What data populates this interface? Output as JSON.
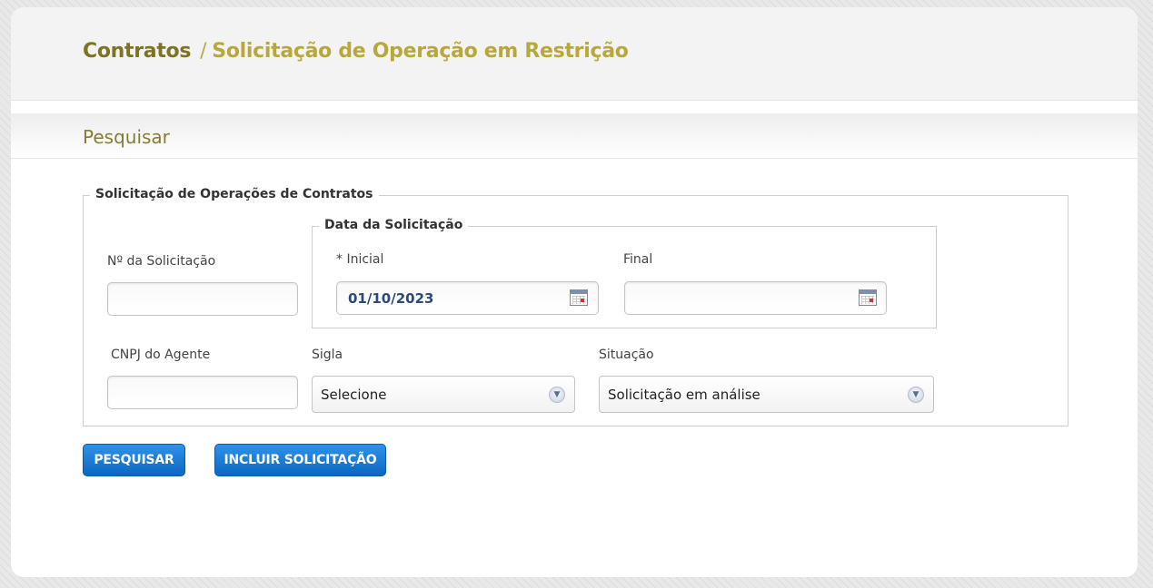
{
  "header": {
    "breadcrumb_root": "Contratos",
    "breadcrumb_separator": "/",
    "breadcrumb_current": "Solicitação de Operação em Restrição"
  },
  "section": {
    "title": "Pesquisar"
  },
  "form": {
    "legend": "Solicitação de Operações de Contratos",
    "numero_label": "Nº da Solicitação",
    "numero_value": "",
    "data_legend": "Data da Solicitação",
    "inicial_label": "* Inicial",
    "inicial_value": "01/10/2023",
    "final_label": "Final",
    "final_value": "",
    "cnpj_label": "CNPJ do Agente",
    "cnpj_value": "",
    "sigla_label": "Sigla",
    "sigla_selected": "Selecione",
    "situacao_label": "Situação",
    "situacao_selected": "Solicitação em análise"
  },
  "buttons": {
    "pesquisar": "PESQUISAR",
    "incluir": "INCLUIR SOLICITAÇÃO"
  },
  "icons": {
    "calendar": "calendar-icon",
    "dropdown": "chevron-down-icon"
  },
  "colors": {
    "brand_olive": "#7d7325",
    "brand_gold": "#b8a83c",
    "button_blue": "#0b67c2"
  }
}
